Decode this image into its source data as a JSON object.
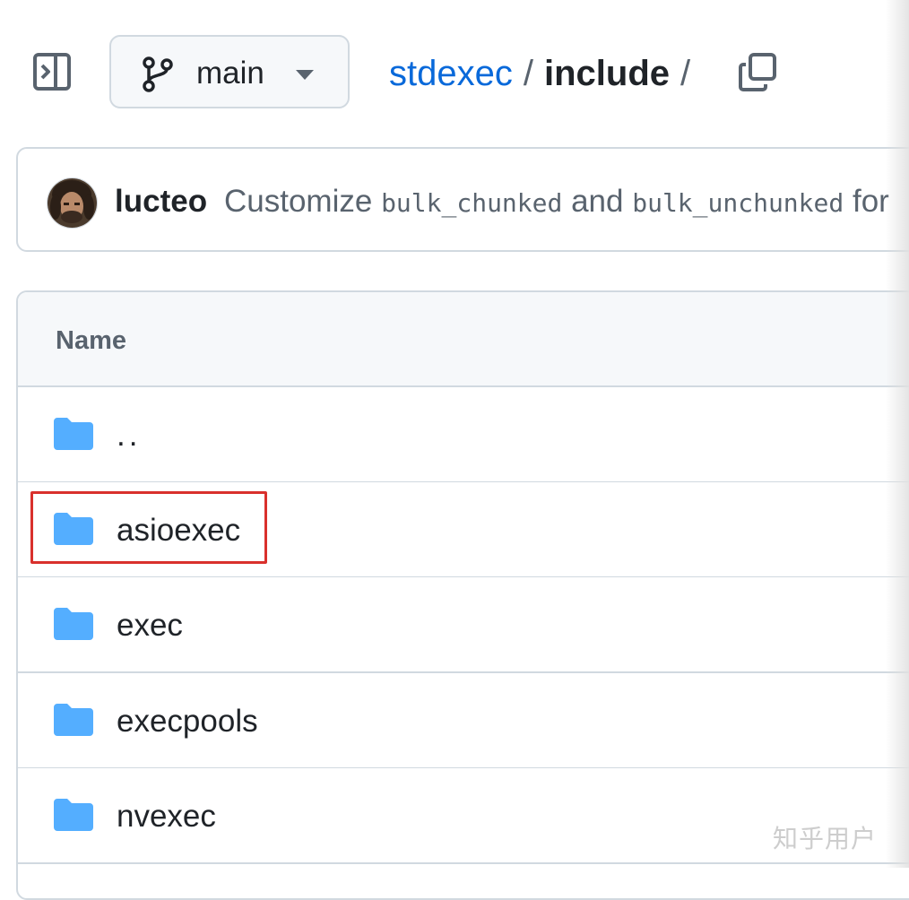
{
  "repo": {
    "branch": "main",
    "breadcrumb_repo": "stdexec",
    "breadcrumb_sep1": "/",
    "breadcrumb_current": "include",
    "breadcrumb_sep2": "/"
  },
  "commit": {
    "author": "lucteo",
    "message_prefix": "Customize",
    "code1": "bulk_chunked",
    "message_mid": "and",
    "code2": "bulk_unchunked",
    "message_suffix": "for"
  },
  "table": {
    "header": "Name",
    "rows": [
      {
        "label": "..",
        "icon": "folder-icon"
      },
      {
        "label": "asioexec",
        "icon": "folder-icon"
      },
      {
        "label": "exec",
        "icon": "folder-icon"
      },
      {
        "label": "execpools",
        "icon": "folder-icon"
      },
      {
        "label": "nvexec",
        "icon": "folder-icon"
      }
    ]
  },
  "annotation": {
    "highlighted_row": "asioexec",
    "color": "#d9302c"
  },
  "watermark": "知乎用户",
  "colors": {
    "link": "#0969da",
    "folder": "#54aeff",
    "border": "#d1d9e0"
  }
}
